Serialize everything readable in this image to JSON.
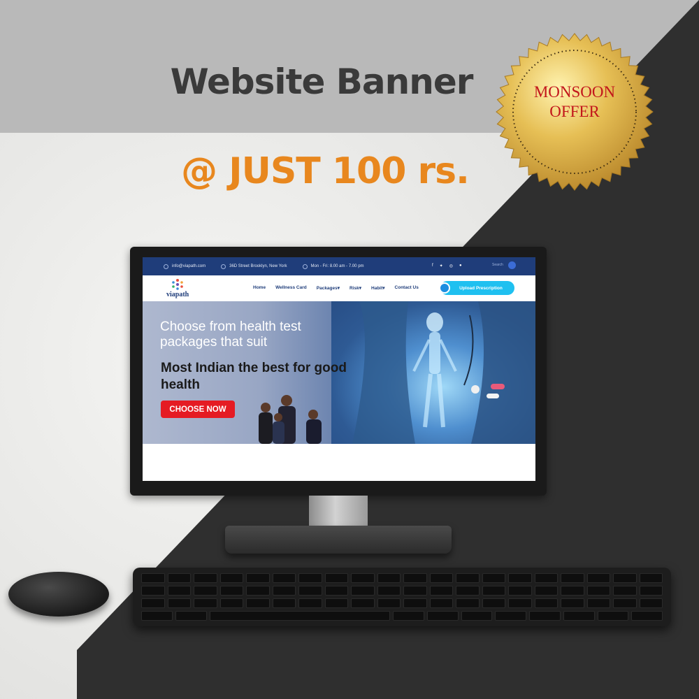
{
  "banner": {
    "headline": "Website Banner",
    "price": "@ JUST 100 rs.",
    "seal_line1": "MONSOON",
    "seal_line2": "OFFER"
  },
  "colors": {
    "price_orange": "#e8871e",
    "seal_gold": "#d9a93a",
    "seal_text_red": "#c2161b",
    "site_navy": "#1f3d7a",
    "cta_red": "#e51b23",
    "upload_cyan": "#1fc0f0"
  },
  "website": {
    "topbar": {
      "email": "info@viapath.com",
      "address": "36D Street Brooklyn, New York",
      "hours": "Mon - Fri: 8.00 am - 7.00 pm",
      "search_placeholder": "Search",
      "social_icons": [
        "facebook-icon",
        "twitter-icon",
        "instagram-icon",
        "pinterest-icon"
      ]
    },
    "logo_text": "viapath",
    "menu": {
      "home": "Home",
      "wellness": "Wellness Card",
      "packages": "Packages▾",
      "risk": "Risk▾",
      "habit": "Habit▾",
      "contact": "Contact Us"
    },
    "upload_button": "Upload Prescription",
    "hero": {
      "line1": "Choose from health test packages that suit",
      "line2": "Most Indian the best for good health",
      "cta": "CHOOSE NOW"
    }
  }
}
